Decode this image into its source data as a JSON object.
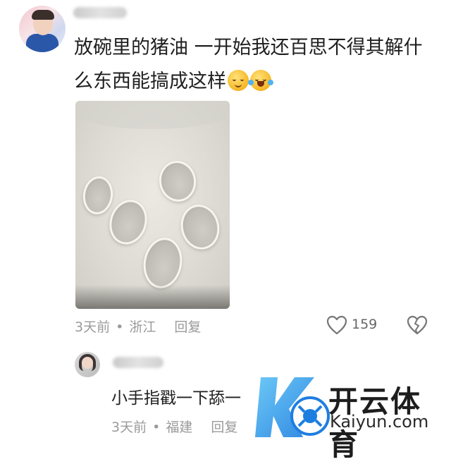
{
  "comment": {
    "text": "放碗里的猪油 一开始我还百思不得其解什么东西能搞成这样",
    "emojis": [
      "smirk-emoji",
      "rofl-emoji"
    ],
    "time": "3天前",
    "location": "浙江",
    "reply_label": "回复",
    "like_count": "159"
  },
  "reply": {
    "text": "小手指戳一下舔一",
    "time": "3天前",
    "location": "福建",
    "reply_label": "回复"
  },
  "watermark": {
    "brand_cn": "开云体育",
    "brand_en": "Kaiyun.com",
    "colors": {
      "accent": "#1e7ee0",
      "logo_light": "#5fc3f5"
    }
  },
  "colors": {
    "meta_text": "#9a9a9a",
    "body_text": "#1f1f1f"
  }
}
